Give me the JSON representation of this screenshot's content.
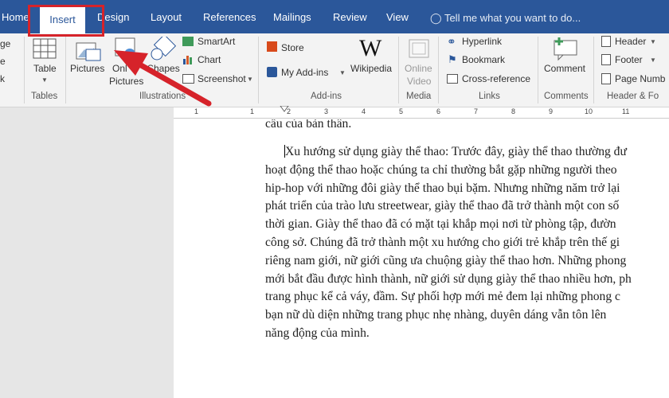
{
  "tabs": [
    "Home",
    "Insert",
    "Design",
    "Layout",
    "References",
    "Mailings",
    "Review",
    "View"
  ],
  "tell_me": "Tell me what you want to do...",
  "left_clip": [
    "ge",
    "e",
    "k"
  ],
  "groups": {
    "tables": {
      "label": "Tables",
      "table": "Table"
    },
    "illustrations": {
      "label": "Illustrations",
      "pictures": "Pictures",
      "online_pictures_1": "Onl",
      "online_pictures_2": "Pictures",
      "shapes": "Shapes",
      "smartart": "SmartArt",
      "chart": "Chart",
      "screenshot": "Screenshot"
    },
    "addins": {
      "label": "Add-ins",
      "store": "Store",
      "my_addins": "My Add-ins",
      "wikipedia": "Wikipedia"
    },
    "media": {
      "label": "Media",
      "online_video_1": "Online",
      "online_video_2": "Video"
    },
    "links": {
      "label": "Links",
      "hyperlink": "Hyperlink",
      "bookmark": "Bookmark",
      "cross_reference": "Cross-reference"
    },
    "comments": {
      "label": "Comments",
      "comment": "Comment"
    },
    "header_footer": {
      "label": "Header & Fo",
      "header": "Header",
      "footer": "Footer",
      "page_number": "Page Numb"
    }
  },
  "ruler_numbers": [
    "1",
    "1",
    "2",
    "3",
    "4",
    "5",
    "6",
    "7",
    "8",
    "9",
    "10",
    "11"
  ],
  "document": {
    "top_partial": "cầu của bản thân.",
    "lines": [
      "Xu hướng sử dụng giày thể thao: Trước đây, giày thể thao thường đư",
      "hoạt động thể thao hoặc chúng ta chỉ thường bắt gặp những người theo",
      "hip-hop với những đôi giày thể thao bụi bặm. Nhưng những năm trở lại",
      "phát triển của trào lưu streetwear, giày thể thao đã trở thành một con số",
      "thời gian. Giày thể thao đã có mặt tại khắp mọi nơi từ phòng tập, đườn",
      "công sở. Chúng đã trở thành một xu hướng cho giới trẻ khắp trên thế gi",
      "riêng nam giới, nữ giới cũng ưa chuộng giày thể thao hơn. Những phong",
      "mới bắt đầu được hình thành, nữ giới sử dụng giày thể thao nhiều hơn, ph",
      "trang phục kể cả váy, đầm. Sự phối hợp mới mẻ đem lại những phong c",
      "bạn nữ dù diện những trang phục nhẹ nhàng, duyên dáng vẫn tôn lên",
      "năng động của mình."
    ]
  },
  "colors": {
    "ribbon_blue": "#2b579a",
    "annotation_red": "#d6232a"
  }
}
